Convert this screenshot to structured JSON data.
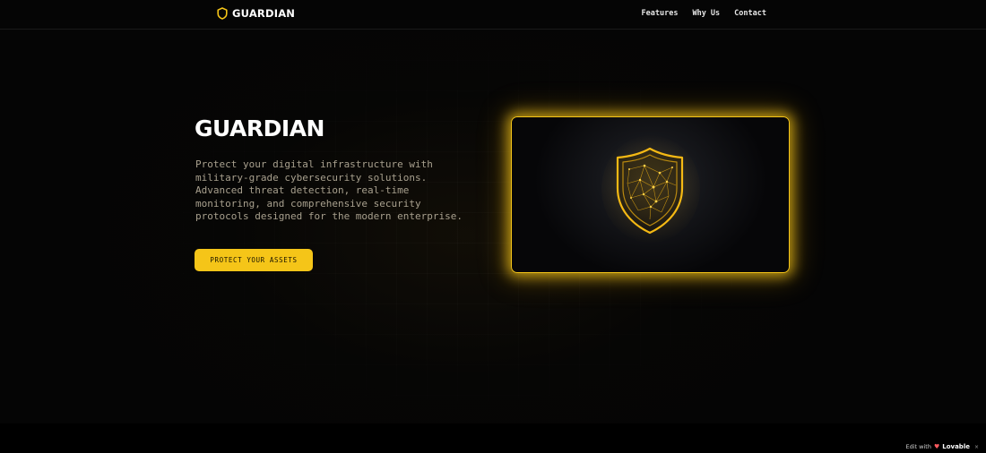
{
  "header": {
    "brand": "GUARDIAN",
    "logo_icon": "shield-outline-icon",
    "nav": [
      {
        "label": "Features"
      },
      {
        "label": "Why Us"
      },
      {
        "label": "Contact"
      }
    ]
  },
  "hero": {
    "title": "GUARDIAN",
    "description": "Protect your digital infrastructure with military-grade cybersecurity solutions. Advanced threat detection, real-time monitoring, and comprehensive security protocols designed for the modern enterprise.",
    "cta_label": "PROTECT YOUR ASSETS",
    "image_icon": "glowing-shield-icon"
  },
  "badge": {
    "prefix": "Edit with",
    "brand": "Lovable",
    "close": "×"
  },
  "colors": {
    "accent": "#f5c518",
    "background": "#050505",
    "text": "#ffffff",
    "muted_text": "#a8a08e"
  }
}
